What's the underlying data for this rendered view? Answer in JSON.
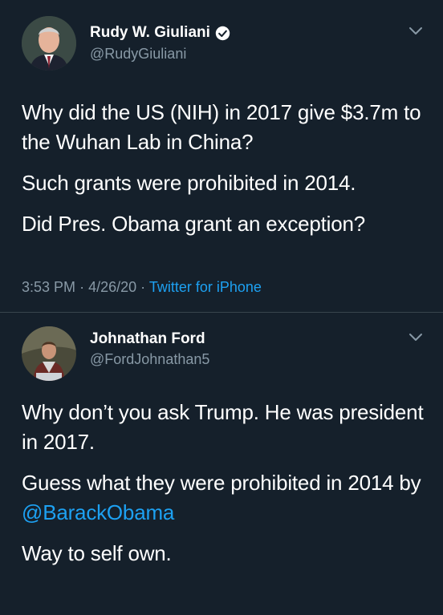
{
  "tweets": [
    {
      "display_name": "Rudy W. Giuliani",
      "verified": true,
      "handle": "@RudyGiuliani",
      "paragraphs": [
        "Why did the US (NIH) in 2017 give $3.7m to the Wuhan Lab in China?",
        "Such grants were prohibited in 2014.",
        "Did Pres. Obama grant an exception?"
      ],
      "time": "3:53 PM",
      "date": "4/26/20",
      "separator": "·",
      "source": "Twitter for iPhone",
      "avatar_icon": "profile-photo"
    },
    {
      "display_name": "Johnathan Ford",
      "verified": false,
      "handle": "@FordJohnathan5",
      "paragraph_1": "Why don’t you ask Trump. He was president in 2017.",
      "paragraph_2_text": "Guess what they were prohibited in 2014 by ",
      "paragraph_2_mention": "@BarackObama",
      "paragraph_3": "Way to self own.",
      "avatar_icon": "profile-photo"
    }
  ],
  "icons": {
    "verified": "verified-badge-icon",
    "more": "chevron-down-icon"
  },
  "colors": {
    "background": "#15202b",
    "text": "#ffffff",
    "secondary_text": "#8899a6",
    "accent": "#1da1f2",
    "divider": "#38444d"
  }
}
